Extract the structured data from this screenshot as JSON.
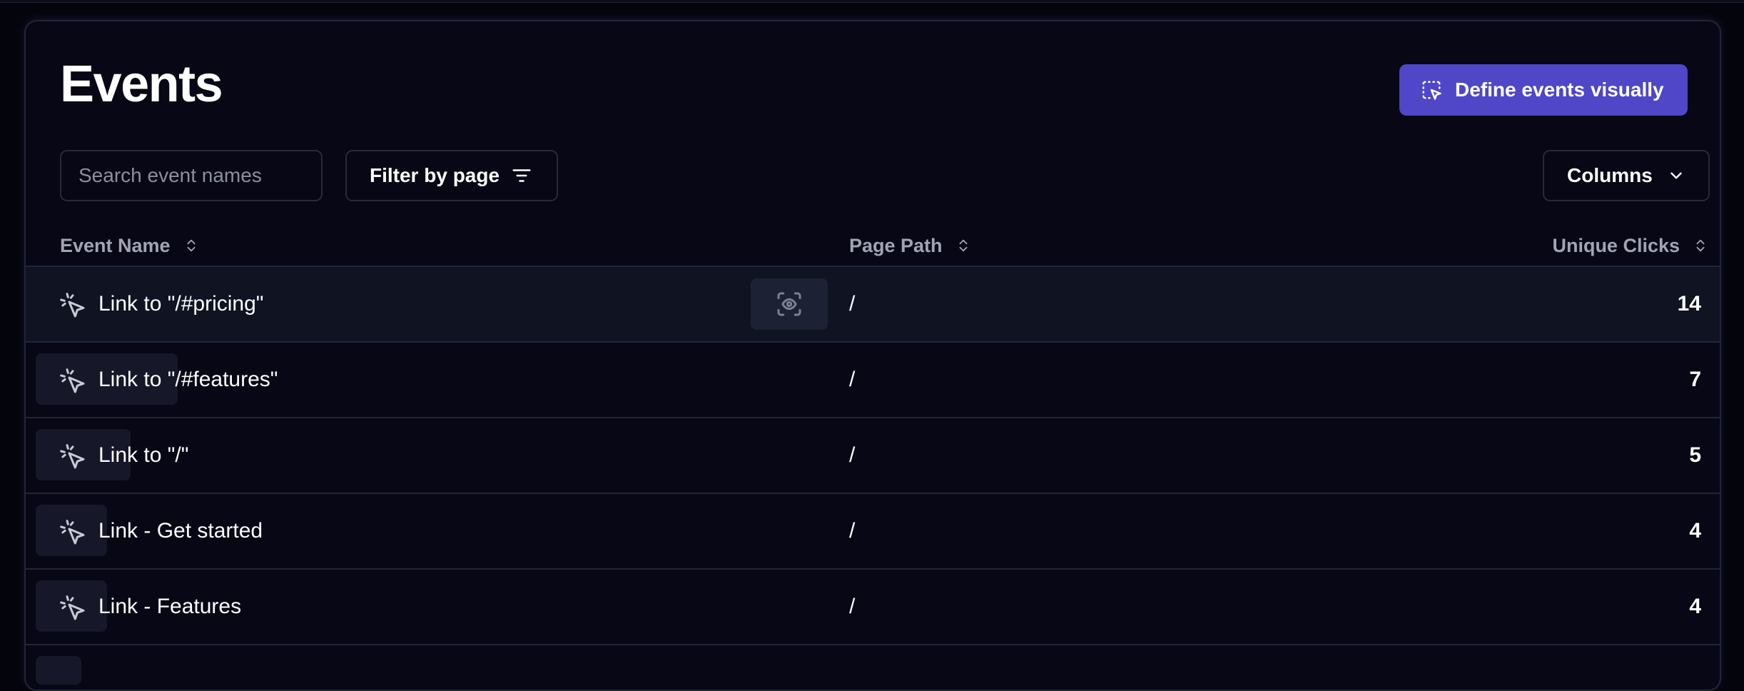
{
  "page": {
    "title": "Events",
    "define_button": "Define events visually",
    "search_placeholder": "Search event names",
    "filter_button": "Filter by page",
    "columns_button": "Columns"
  },
  "table": {
    "headers": {
      "event_name": "Event Name",
      "page_path": "Page Path",
      "unique_clicks": "Unique Clicks"
    },
    "rows": [
      {
        "name": "Link to \"/#pricing\"",
        "path": "/",
        "clicks": "14"
      },
      {
        "name": "Link to \"/#features\"",
        "path": "/",
        "clicks": "7"
      },
      {
        "name": "Link to \"/\"",
        "path": "/",
        "clicks": "5"
      },
      {
        "name": "Link - Get started",
        "path": "/",
        "clicks": "4"
      },
      {
        "name": "Link - Features",
        "path": "/",
        "clicks": "4"
      }
    ]
  },
  "icons": {
    "define": "select-pointer-icon",
    "filter": "filter-lines-icon",
    "columns": "chevron-down-icon",
    "sort": "sort-updown-icon",
    "row": "click-cursor-icon",
    "view": "eye-scan-icon"
  },
  "colors": {
    "accent": "#4f46c8",
    "background": "#070715",
    "border": "#22253a",
    "muted_text": "#a0a4b4"
  }
}
